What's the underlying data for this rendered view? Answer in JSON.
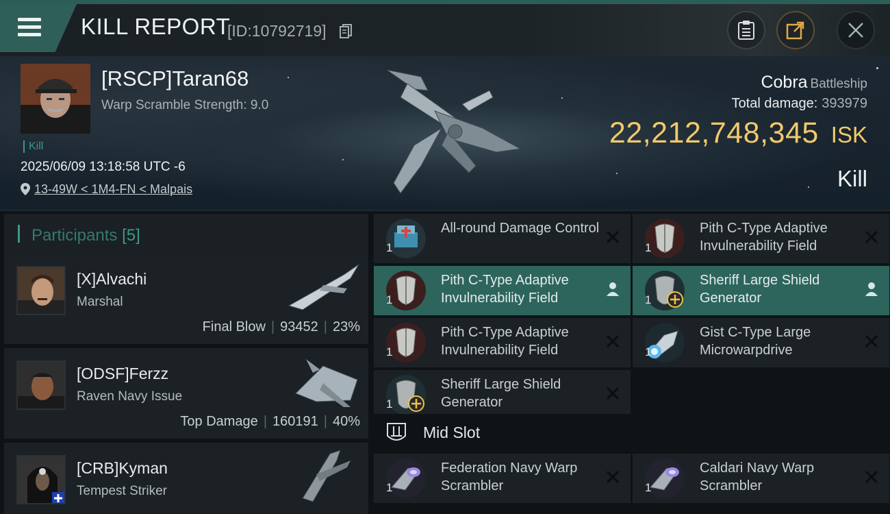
{
  "header": {
    "title": "KILL REPORT",
    "report_id": "[ID:10792719]",
    "icons": [
      "menu-icon",
      "copy-icon",
      "clipboard-icon",
      "share-icon",
      "close-icon"
    ]
  },
  "victim": {
    "name": "[RSCP]Taran68",
    "warp_scramble": "Warp Scramble Strength: 9.0",
    "kill_tag": "Kill",
    "datetime": "2025/06/09 13:18:58 UTC -6",
    "location": "13-49W < 1M4-FN < Malpais",
    "ship_name": "Cobra",
    "ship_class": "Battleship",
    "total_damage_label": "Total damage:",
    "total_damage": "393979",
    "isk_value": "22,212,748,345",
    "isk_unit": "ISK",
    "status": "Kill"
  },
  "participants": {
    "label": "Participants",
    "count": "[5]",
    "list": [
      {
        "name": "[X]Alvachi",
        "ship": "Marshal",
        "role": "Final Blow",
        "damage": "93452",
        "percent": "23%"
      },
      {
        "name": "[ODSF]Ferzz",
        "ship": "Raven Navy Issue",
        "role": "Top Damage",
        "damage": "160191",
        "percent": "40%"
      },
      {
        "name": "[CRB]Kyman",
        "ship": "Tempest Striker",
        "role": "",
        "damage": "",
        "percent": ""
      }
    ]
  },
  "modules": {
    "items": [
      {
        "name": "All-round Damage Control",
        "qty": "1",
        "status": "destroyed"
      },
      {
        "name": "Pith C-Type Adaptive Invulnerability Field",
        "qty": "1",
        "status": "destroyed"
      },
      {
        "name": "Pith C-Type Adaptive Invulnerability Field",
        "qty": "1",
        "status": "dropped"
      },
      {
        "name": "Sheriff Large Shield Generator",
        "qty": "1",
        "status": "dropped"
      },
      {
        "name": "Pith C-Type Adaptive Invulnerability Field",
        "qty": "1",
        "status": "destroyed"
      },
      {
        "name": "Gist C-Type Large Microwarpdrive",
        "qty": "1",
        "status": "destroyed"
      },
      {
        "name": "Sheriff Large Shield Generator",
        "qty": "1",
        "status": "destroyed"
      }
    ],
    "mid_slot_label": "Mid Slot",
    "mid_items": [
      {
        "name": "Federation Navy Warp Scrambler",
        "qty": "1",
        "status": "destroyed"
      },
      {
        "name": "Caldari Navy Warp Scrambler",
        "qty": "1",
        "status": "destroyed"
      }
    ]
  },
  "colors": {
    "accent": "#2d655d",
    "isk": "#f2c96b",
    "kill_tag": "#3b9a86"
  }
}
